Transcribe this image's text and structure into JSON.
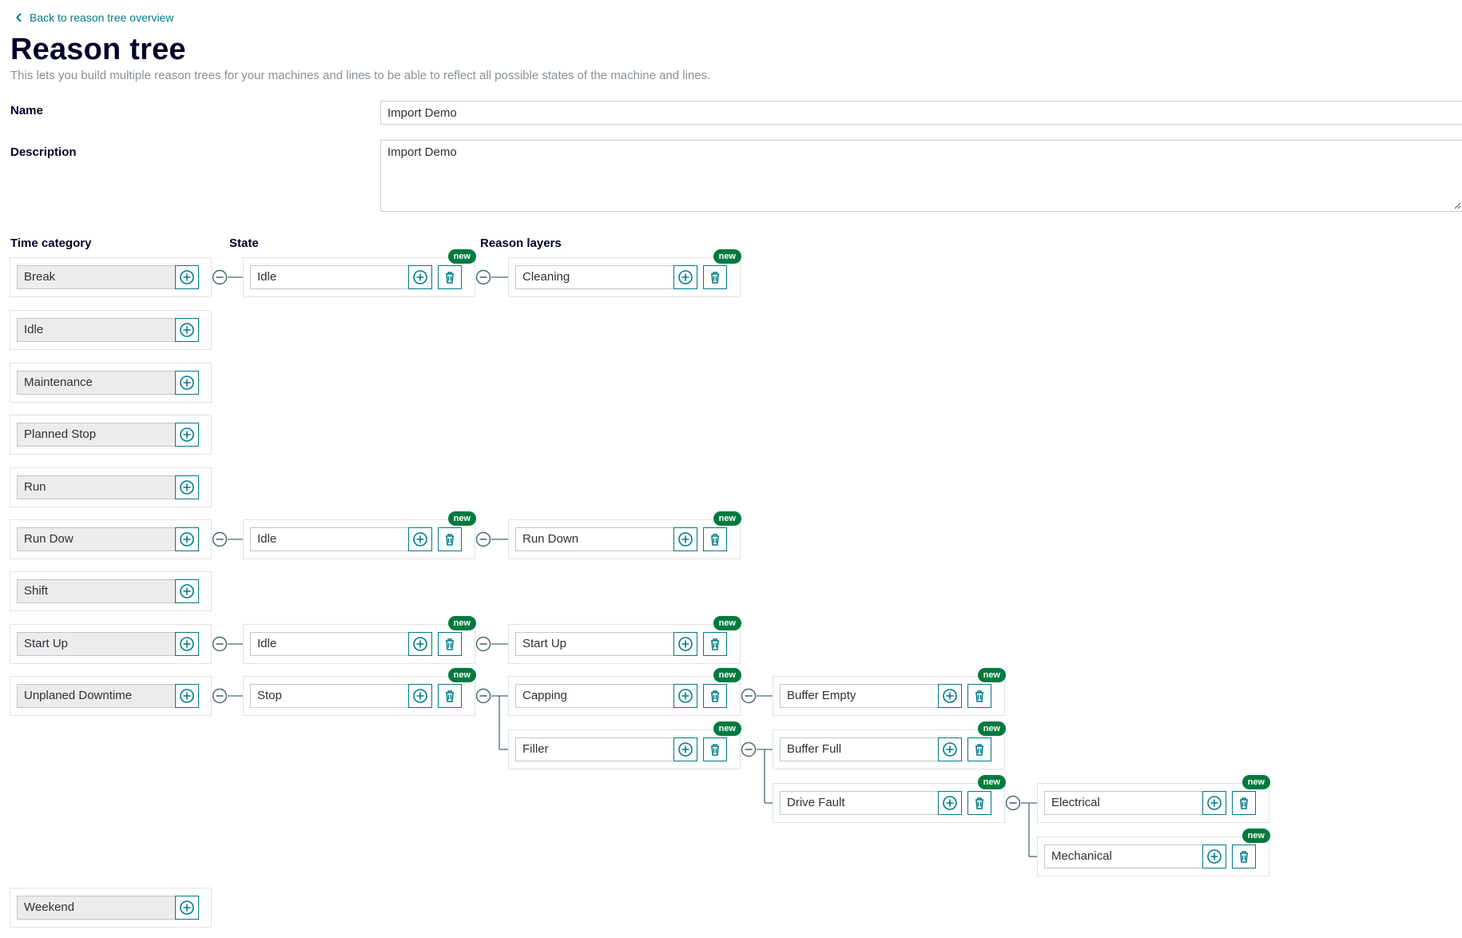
{
  "back_link": "Back to reason tree overview",
  "title": "Reason tree",
  "description": "This lets you build multiple reason trees for your machines and lines to be able to reflect all possible states of the machine and lines.",
  "form": {
    "name_label": "Name",
    "name_value": "Import Demo",
    "description_label": "Description",
    "description_value": "Import Demo"
  },
  "columns": {
    "time_category": "Time category",
    "state": "State",
    "reason_layers": "Reason layers"
  },
  "badge_text": "new",
  "icons": {
    "back": "chevron-left-icon",
    "add": "plus-circle-icon",
    "delete": "trash-icon",
    "collapse": "minus-circle-icon",
    "resize": "resize-grip-icon"
  },
  "colors": {
    "accent": "#007a87",
    "badge": "#007a3f",
    "title": "#000028",
    "muted_text": "#8a8f98"
  },
  "time_categories": [
    {
      "id": "break",
      "label": "Break"
    },
    {
      "id": "idle",
      "label": "Idle"
    },
    {
      "id": "maintenance",
      "label": "Maintenance"
    },
    {
      "id": "planned-stop",
      "label": "Planned Stop"
    },
    {
      "id": "run",
      "label": "Run"
    },
    {
      "id": "run-dow",
      "label": "Run Dow"
    },
    {
      "id": "shift",
      "label": "Shift"
    },
    {
      "id": "start-up",
      "label": "Start Up"
    },
    {
      "id": "unplaned-downtime",
      "label": "Unplaned Downtime"
    },
    {
      "id": "weekend",
      "label": "Weekend"
    }
  ],
  "states": [
    {
      "id": "break-idle",
      "category": "break",
      "label": "Idle",
      "is_new": true
    },
    {
      "id": "rundow-idle",
      "category": "run-dow",
      "label": "Idle",
      "is_new": true
    },
    {
      "id": "startup-idle",
      "category": "start-up",
      "label": "Idle",
      "is_new": true
    },
    {
      "id": "unplaned-stop",
      "category": "unplaned-downtime",
      "label": "Stop",
      "is_new": true
    }
  ],
  "reasons": [
    {
      "id": "cleaning",
      "parent": "break-idle",
      "layer": 1,
      "label": "Cleaning",
      "is_new": true
    },
    {
      "id": "run-down",
      "parent": "rundow-idle",
      "layer": 1,
      "label": "Run Down",
      "is_new": true
    },
    {
      "id": "start-up-reason",
      "parent": "startup-idle",
      "layer": 1,
      "label": "Start Up",
      "is_new": true
    },
    {
      "id": "capping",
      "parent": "unplaned-stop",
      "layer": 1,
      "label": "Capping",
      "is_new": true
    },
    {
      "id": "filler",
      "parent": "unplaned-stop",
      "layer": 1,
      "label": "Filler",
      "is_new": true
    },
    {
      "id": "buffer-empty",
      "parent": "capping",
      "layer": 2,
      "label": "Buffer Empty",
      "is_new": true
    },
    {
      "id": "buffer-full",
      "parent": "filler",
      "layer": 2,
      "label": "Buffer Full",
      "is_new": true
    },
    {
      "id": "drive-fault",
      "parent": "filler",
      "layer": 2,
      "label": "Drive Fault",
      "is_new": true
    },
    {
      "id": "electrical",
      "parent": "drive-fault",
      "layer": 3,
      "label": "Electrical",
      "is_new": true
    },
    {
      "id": "mechanical",
      "parent": "drive-fault",
      "layer": 3,
      "label": "Mechanical",
      "is_new": true
    }
  ]
}
